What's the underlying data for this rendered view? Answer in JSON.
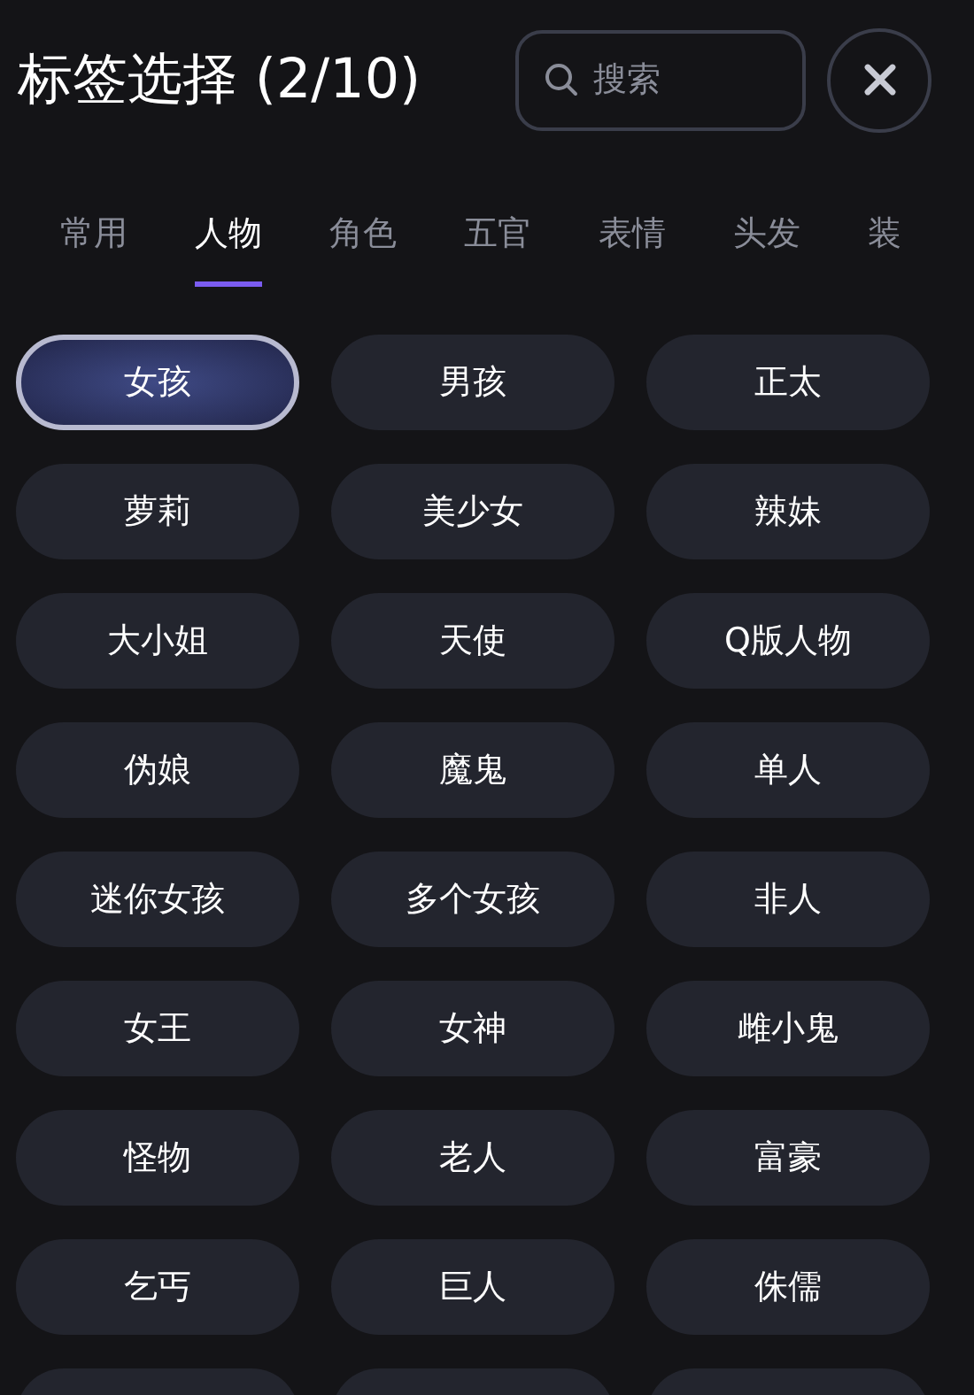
{
  "header": {
    "title": "标签选择 (2/10)",
    "search": {
      "placeholder": "搜索"
    }
  },
  "tabs": [
    {
      "label": "常用",
      "selected": false
    },
    {
      "label": "人物",
      "selected": true
    },
    {
      "label": "角色",
      "selected": false
    },
    {
      "label": "五官",
      "selected": false
    },
    {
      "label": "表情",
      "selected": false
    },
    {
      "label": "头发",
      "selected": false
    },
    {
      "label": "装",
      "selected": false
    }
  ],
  "tags": [
    {
      "label": "女孩",
      "selected": true
    },
    {
      "label": "男孩",
      "selected": false
    },
    {
      "label": "正太",
      "selected": false
    },
    {
      "label": "萝莉",
      "selected": false
    },
    {
      "label": "美少女",
      "selected": false
    },
    {
      "label": "辣妹",
      "selected": false
    },
    {
      "label": "大小姐",
      "selected": false
    },
    {
      "label": "天使",
      "selected": false
    },
    {
      "label": "Q版人物",
      "selected": false
    },
    {
      "label": "伪娘",
      "selected": false
    },
    {
      "label": "魔鬼",
      "selected": false
    },
    {
      "label": "单人",
      "selected": false
    },
    {
      "label": "迷你女孩",
      "selected": false
    },
    {
      "label": "多个女孩",
      "selected": false
    },
    {
      "label": "非人",
      "selected": false
    },
    {
      "label": "女王",
      "selected": false
    },
    {
      "label": "女神",
      "selected": false
    },
    {
      "label": "雌小鬼",
      "selected": false
    },
    {
      "label": "怪物",
      "selected": false
    },
    {
      "label": "老人",
      "selected": false
    },
    {
      "label": "富豪",
      "selected": false
    },
    {
      "label": "乞丐",
      "selected": false
    },
    {
      "label": "巨人",
      "selected": false
    },
    {
      "label": "侏儒",
      "selected": false
    },
    {
      "selected": false
    },
    {
      "selected": false
    },
    {
      "selected": false
    }
  ]
}
